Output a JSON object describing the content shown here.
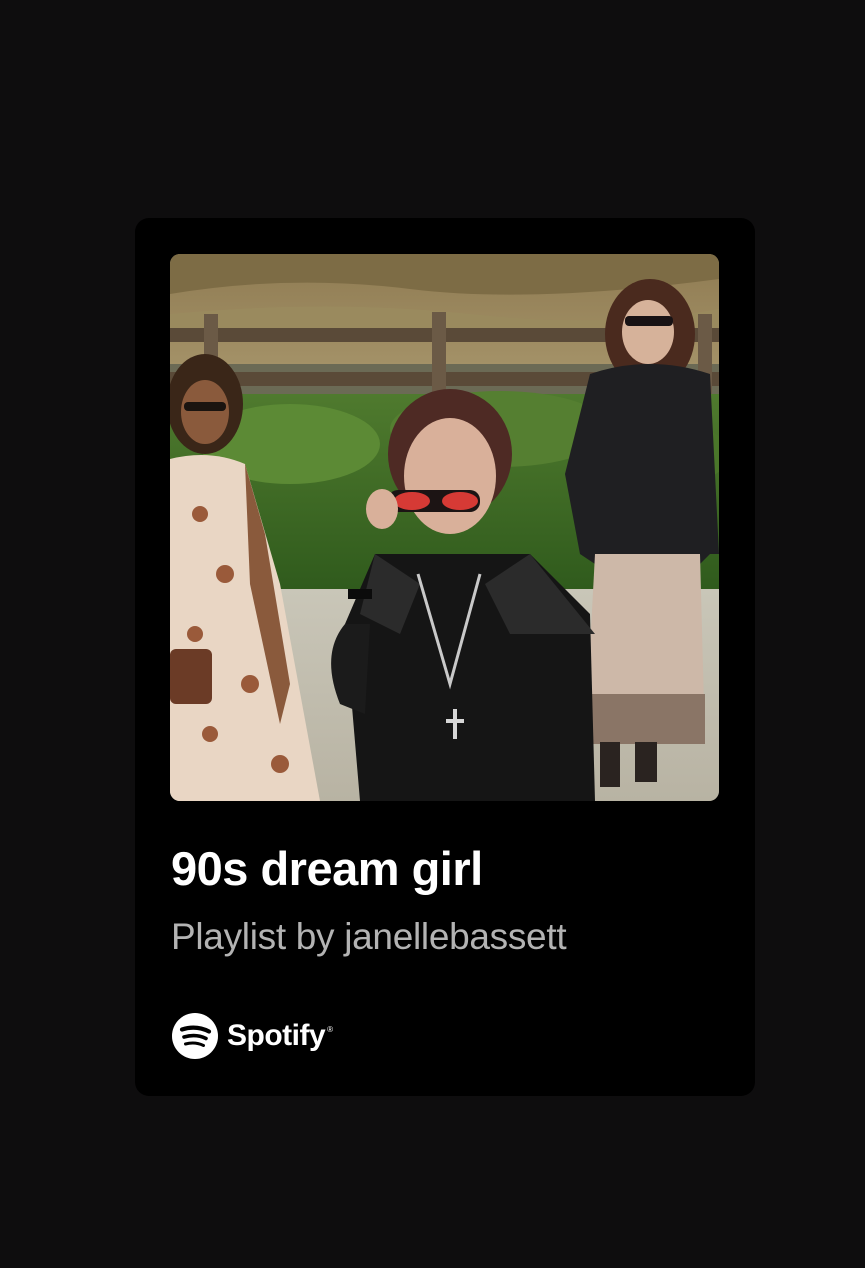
{
  "playlist": {
    "title": "90s dream girl",
    "subtitle": "Playlist by janellebassett",
    "cover_alt": "Three young women in 90s fashion walking in front of a wooden fence; the one in front lowers red sunglasses"
  },
  "brand": {
    "name": "Spotify",
    "trademark": "®",
    "icon": "spotify-logo-icon"
  },
  "colors": {
    "page_background": "#0e0d0e",
    "card_background": "#000000",
    "title_text": "#ffffff",
    "subtitle_text": "#b3b3b3"
  }
}
